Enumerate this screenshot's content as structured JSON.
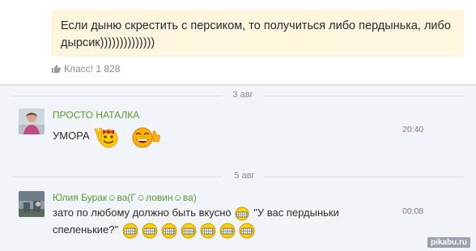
{
  "post": {
    "text": "Если дыню скрестить с персиком, то получиться либо пердынька, либо дырсик))))))))))))))",
    "like_label": "Класс! 1 828"
  },
  "dates": [
    "3 авг",
    "5 авг"
  ],
  "comments": [
    {
      "author": "ПРОСТО НАТАЛКА",
      "text": "УМОРА",
      "time": "20:40"
    },
    {
      "author": "Юлия Бурак☺ва(Г☺ловин☺ва)",
      "text_line1": "зато по любому должно быть  вкусно",
      "text_line1_quote": " \"У вас пердыньки",
      "text_line2": "спеленькие?\"",
      "time": "00:08"
    }
  ],
  "watermark": "pikabu.ru",
  "colors": {
    "bubble": "#fdf5de",
    "feed_bg": "#f1f4f8",
    "author_green": "#5a9a33"
  }
}
